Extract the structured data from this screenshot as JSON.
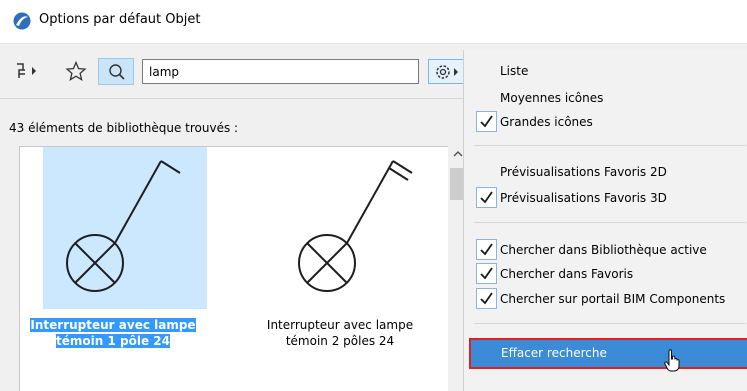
{
  "window": {
    "title": "Options par défaut Objet"
  },
  "toolbar": {
    "search_value": "lamp",
    "icons": [
      "hierarchy-icon",
      "star-icon",
      "search-icon",
      "settings-gear-icon"
    ]
  },
  "results": {
    "count_text": "43 éléments de bibliothèque trouvés :",
    "items": [
      {
        "label_line1": "Interrupteur avec lampe",
        "label_line2": "témoin 1 pôle 24",
        "selected": true
      },
      {
        "label_line1": "Interrupteur avec lampe",
        "label_line2": "témoin 2 pôles 24",
        "selected": false
      }
    ]
  },
  "menu": {
    "view": {
      "list": "Liste",
      "medium_icons": "Moyennes icônes",
      "large_icons": "Grandes icônes"
    },
    "preview": {
      "fav_2d": "Prévisualisations Favoris 2D",
      "fav_3d": "Prévisualisations Favoris 3D"
    },
    "search": {
      "active_library": "Chercher dans Bibliothèque active",
      "favorites": "Chercher dans Favoris",
      "bim_portal": "Chercher sur portail BIM Components"
    },
    "clear_search": "Effacer recherche"
  },
  "colors": {
    "accent": "#3c8bd8",
    "selection": "#3399ff",
    "highlight_outline": "#e02020"
  }
}
